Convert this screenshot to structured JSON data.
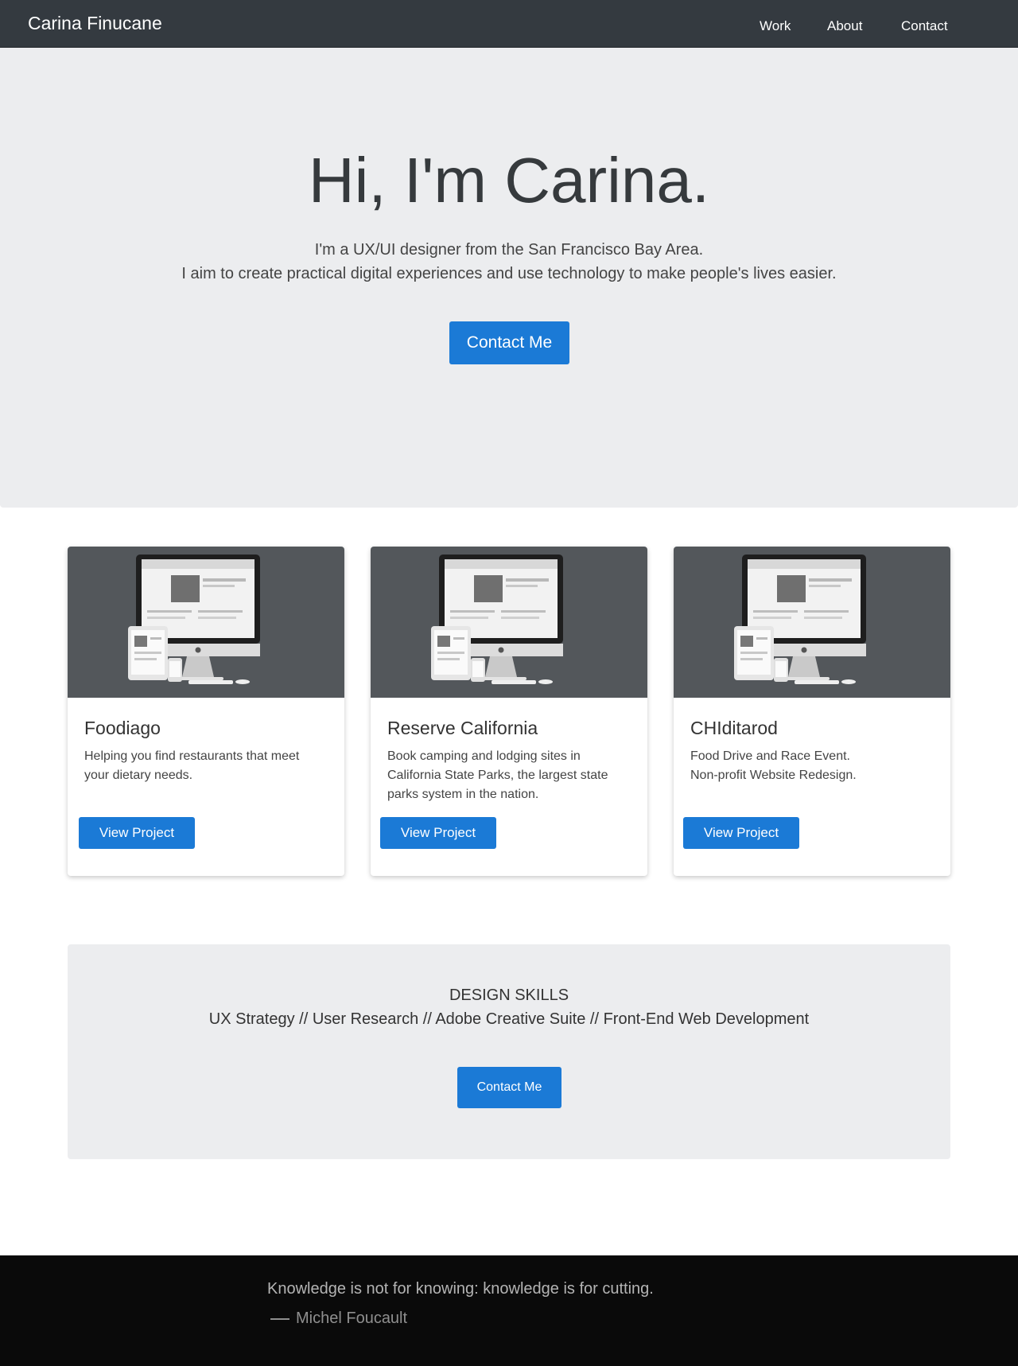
{
  "navbar": {
    "brand": "Carina Finucane",
    "links": [
      "Work",
      "About",
      "Contact"
    ]
  },
  "hero": {
    "title": "Hi, I'm Carina.",
    "line1": "I'm a UX/UI designer from the San Francisco Bay Area.",
    "line2": "I aim to create practical digital experiences and use technology to make people's lives easier.",
    "cta_label": "Contact Me"
  },
  "projects": [
    {
      "title": "Foodiago",
      "description_lines": [
        "Helping you find restaurants that meet",
        "your dietary needs."
      ],
      "button_label": "View Project",
      "image_icon": "devices-mockup-image"
    },
    {
      "title": "Reserve California",
      "description_lines": [
        "Book camping and lodging sites in",
        "California State Parks, the largest state",
        "parks system in the nation."
      ],
      "button_label": "View Project",
      "image_icon": "devices-mockup-image"
    },
    {
      "title": "CHIditarod",
      "description_lines": [
        "Food Drive and Race Event.",
        "Non-profit Website Redesign."
      ],
      "button_label": "View Project",
      "image_icon": "devices-mockup-image"
    }
  ],
  "skills": {
    "heading": "DESIGN SKILLS",
    "list": "UX Strategy // User Research // Adobe Creative Suite // Front-End Web Development",
    "cta_label": "Contact Me"
  },
  "footer": {
    "quote": "Knowledge is not for knowing: knowledge is for cutting.",
    "author": "Michel Foucault"
  },
  "colors": {
    "navbar_bg": "#343a40",
    "hero_bg": "#ecedef",
    "accent_blue": "#1b7ad6",
    "card_image_bg": "#53575b",
    "footer_bg": "#0a0a0a"
  }
}
